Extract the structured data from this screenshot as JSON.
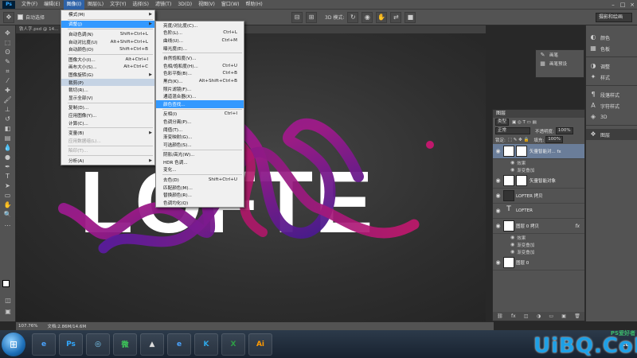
{
  "app": {
    "logo": "Ps"
  },
  "menubar": {
    "items": [
      "文件(F)",
      "编辑(E)",
      "图像(I)",
      "图层(L)",
      "文字(Y)",
      "选择(S)",
      "滤镜(T)",
      "3D(D)",
      "视图(V)",
      "窗口(W)",
      "帮助(H)"
    ],
    "active_index": 2
  },
  "optionsbar": {
    "auto_select_label": "自动选择",
    "mode_3d_label": "3D 模式:",
    "workspace": "摄影和绘画"
  },
  "tabs": [
    {
      "label": "铁人字.psd @ 14...",
      "active": false
    },
    {
      "label": "...形对象, 拷贝, RGB/8)",
      "active": true
    }
  ],
  "image_menu": {
    "items": [
      {
        "label": "模式(M)",
        "shortcut": "",
        "submenu": true
      },
      {
        "sep": true
      },
      {
        "label": "调整(J)",
        "shortcut": "",
        "submenu": true,
        "highlight": "blue"
      },
      {
        "sep": true
      },
      {
        "label": "自动色调(N)",
        "shortcut": "Shift+Ctrl+L"
      },
      {
        "label": "自动对比度(U)",
        "shortcut": "Alt+Shift+Ctrl+L"
      },
      {
        "label": "自动颜色(O)",
        "shortcut": "Shift+Ctrl+B"
      },
      {
        "sep": true
      },
      {
        "label": "图像大小(I)...",
        "shortcut": "Alt+Ctrl+I"
      },
      {
        "label": "画布大小(S)...",
        "shortcut": "Alt+Ctrl+C"
      },
      {
        "label": "图像旋转(G)",
        "shortcut": "",
        "submenu": true
      },
      {
        "label": "裁剪(P)",
        "shortcut": "",
        "highlight": "grey"
      },
      {
        "label": "裁切(R)...",
        "shortcut": ""
      },
      {
        "label": "显示全部(V)",
        "shortcut": ""
      },
      {
        "sep": true
      },
      {
        "label": "复制(D)...",
        "shortcut": ""
      },
      {
        "label": "应用图像(Y)...",
        "shortcut": ""
      },
      {
        "label": "计算(C)...",
        "shortcut": ""
      },
      {
        "sep": true
      },
      {
        "label": "变量(B)",
        "shortcut": "",
        "submenu": true
      },
      {
        "label": "应用数据组(L)...",
        "shortcut": "",
        "disabled": true
      },
      {
        "sep": true
      },
      {
        "label": "陷印(T)...",
        "shortcut": "",
        "disabled": true
      },
      {
        "sep": true
      },
      {
        "label": "分析(A)",
        "shortcut": "",
        "submenu": true
      }
    ]
  },
  "adjust_menu": {
    "items": [
      {
        "label": "亮度/对比度(C)...",
        "shortcut": ""
      },
      {
        "label": "色阶(L)...",
        "shortcut": "Ctrl+L"
      },
      {
        "label": "曲线(U)...",
        "shortcut": "Ctrl+M"
      },
      {
        "label": "曝光度(E)...",
        "shortcut": ""
      },
      {
        "sep": true
      },
      {
        "label": "自然饱和度(V)...",
        "shortcut": ""
      },
      {
        "label": "色相/饱和度(H)...",
        "shortcut": "Ctrl+U"
      },
      {
        "label": "色彩平衡(B)...",
        "shortcut": "Ctrl+B"
      },
      {
        "label": "黑白(K)...",
        "shortcut": "Alt+Shift+Ctrl+B"
      },
      {
        "label": "照片滤镜(F)...",
        "shortcut": ""
      },
      {
        "label": "通道混合器(X)...",
        "shortcut": ""
      },
      {
        "label": "颜色查找...",
        "shortcut": "",
        "highlight": "blue"
      },
      {
        "sep": true
      },
      {
        "label": "反相(I)",
        "shortcut": "Ctrl+I"
      },
      {
        "label": "色调分离(P)...",
        "shortcut": ""
      },
      {
        "label": "阈值(T)...",
        "shortcut": ""
      },
      {
        "label": "渐变映射(G)...",
        "shortcut": ""
      },
      {
        "label": "可选颜色(S)...",
        "shortcut": ""
      },
      {
        "sep": true
      },
      {
        "label": "阴影/高光(W)...",
        "shortcut": ""
      },
      {
        "label": "HDR 色调...",
        "shortcut": ""
      },
      {
        "label": "变化...",
        "shortcut": ""
      },
      {
        "sep": true
      },
      {
        "label": "去色(D)",
        "shortcut": "Shift+Ctrl+U"
      },
      {
        "label": "匹配颜色(M)...",
        "shortcut": ""
      },
      {
        "label": "替换颜色(R)...",
        "shortcut": ""
      },
      {
        "label": "色调均化(Q)",
        "shortcut": ""
      }
    ]
  },
  "canvas": {
    "text": "LOFTE"
  },
  "status": {
    "zoom": "107.76%",
    "doc": "文档:2.86M/14.6M"
  },
  "history_panel": {
    "items": [
      "画笔",
      "画笔预设"
    ]
  },
  "dock": {
    "items": [
      "颜色",
      "色板",
      "调整",
      "样式",
      "段落样式",
      "字符样式",
      "3D",
      "图层"
    ]
  },
  "layers_panel": {
    "title": "图层",
    "kind_label": "类型",
    "blend_mode": "正常",
    "opacity_label": "不透明度:",
    "opacity": "100%",
    "lock_label": "锁定:",
    "fill_label": "填充:",
    "fill": "100%",
    "layers": [
      {
        "name": "矢量智能对... fx",
        "selected": true,
        "mask": true,
        "effects": [
          "效果",
          "渐变叠加"
        ]
      },
      {
        "name": "矢量智能对象",
        "selected": false,
        "mask": true,
        "effects": []
      },
      {
        "name": "LOFTER 拷贝",
        "selected": false,
        "mask": false,
        "text": false,
        "effects": []
      },
      {
        "name": "LOFTER",
        "selected": false,
        "mask": false,
        "text": true,
        "effects": []
      },
      {
        "name": "图层 0 拷贝",
        "selected": false,
        "mask": false,
        "fx": true,
        "effects": [
          "效果",
          "渐变叠加",
          "渐变叠加"
        ]
      },
      {
        "name": "图层 0",
        "selected": false,
        "mask": false,
        "effects": []
      }
    ]
  },
  "taskbar": {
    "apps": [
      "e",
      "Ps",
      "◎",
      "微",
      "▲",
      "e",
      "K",
      "X",
      "Ai"
    ],
    "tray_text": "CE"
  },
  "watermark": {
    "text": "UiBQ.CoM",
    "site": "PS爱好者"
  }
}
